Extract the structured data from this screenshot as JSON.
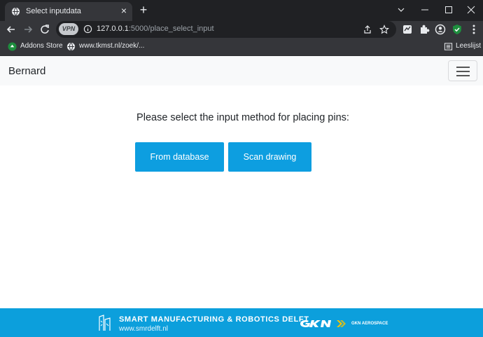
{
  "browser": {
    "tab": {
      "title": "Select inputdata",
      "favicon": "globe-icon",
      "close_icon": "close-icon"
    },
    "new_tab_icon": "plus-icon",
    "window_controls": [
      "chevron-down-icon",
      "minimize-icon",
      "maximize-icon",
      "close-icon"
    ],
    "toolbar": {
      "vpn_label": "VPN",
      "url_host": "127.0.0.1",
      "url_path": ":5000/place_select_input",
      "icons": [
        "back-arrow-icon",
        "forward-arrow-icon",
        "reload-icon",
        "info-icon",
        "share-icon",
        "star-icon",
        "extension-shield-icon",
        "puzzle-icon",
        "profile-icon",
        "shield-check-icon",
        "more-vert-icon"
      ]
    },
    "bookmarks": {
      "items": [
        {
          "label": "Addons Store",
          "icon": "addons-store-icon"
        },
        {
          "label": "www.tkmst.nl/zoek/...",
          "icon": "globe-icon"
        }
      ],
      "reading_list": "Leeslijst"
    }
  },
  "navbar": {
    "brand": "Bernard",
    "menu_icon": "hamburger-icon"
  },
  "main": {
    "prompt": "Please select the input method for placing pins:",
    "buttons": [
      {
        "label": "From database"
      },
      {
        "label": "Scan drawing"
      }
    ]
  },
  "footer": {
    "title": "SMART MANUFACTURING & ROBOTICS DELFT",
    "url": "www.smrdelft.nl",
    "partner": "GKN AEROSPACE",
    "colors": {
      "background": "#0c9fdc"
    }
  },
  "colors": {
    "primary_button": "#0d9ee0",
    "navbar_bg": "#f8f9fa",
    "browser_dark": "#202124"
  }
}
